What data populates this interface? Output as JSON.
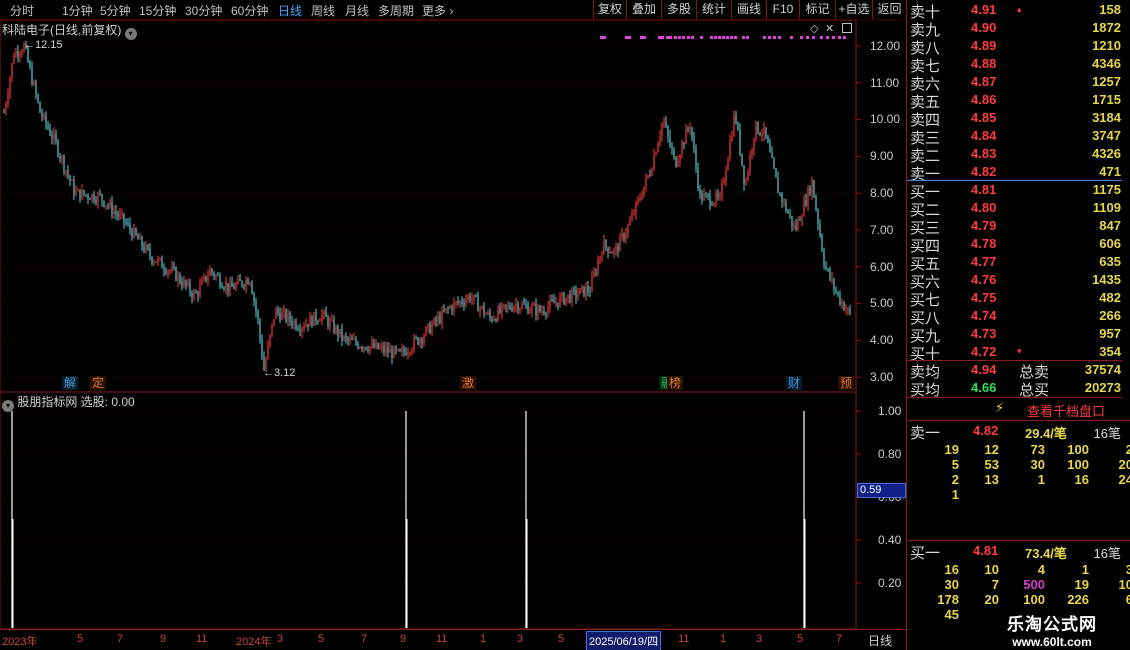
{
  "toolbar": {
    "periods": [
      "分时",
      "1分钟",
      "5分钟",
      "15分钟",
      "30分钟",
      "60分钟",
      "日线",
      "周线",
      "月线",
      "多周期",
      "更多"
    ],
    "active_period": "日线",
    "more_arrow": "›",
    "buttons": [
      "复权",
      "叠加",
      "多股",
      "统计",
      "画线",
      "F10",
      "标记",
      "+自选",
      "返回"
    ]
  },
  "main_chart": {
    "title": "科陆电子(日线,前复权)",
    "high_label": "12.15",
    "low_label": "3.12",
    "y_ticks": [
      "12.00",
      "11.00",
      "10.00",
      "9.00",
      "8.00",
      "7.00",
      "6.00",
      "5.00",
      "4.00",
      "3.00"
    ],
    "badges": [
      {
        "text": "解",
        "color": "#3aa0d8"
      },
      {
        "text": "定",
        "color": "#e07a2a"
      },
      {
        "text": "激",
        "color": "#e07a2a"
      },
      {
        "text": "融",
        "color": "#2ec05a"
      },
      {
        "text": "榜",
        "color": "#e07a2a"
      },
      {
        "text": "财",
        "color": "#3aa0d8"
      },
      {
        "text": "预",
        "color": "#e07a2a"
      }
    ],
    "up_color": "#ff3b3b",
    "down_color": "#5ad0d8",
    "magenta_marker_color": "#e040e0"
  },
  "sub_chart": {
    "title": "股朋指标网 选股: 0.00",
    "y_ticks": [
      "1.00",
      "0.80",
      "0.60",
      "0.40",
      "0.20"
    ],
    "crosshair_value": "0.59"
  },
  "time_axis": {
    "ticks": [
      "2023年",
      "5",
      "7",
      "9",
      "11",
      "2024年",
      "3",
      "5",
      "7",
      "9",
      "11",
      "1",
      "3",
      "5",
      "7",
      "2025/06/19/四",
      "11",
      "1",
      "3",
      "5",
      "7"
    ],
    "period_label": "日线"
  },
  "order_book": {
    "asks": [
      {
        "label": "卖十",
        "price": "4.91",
        "vol": "158"
      },
      {
        "label": "卖九",
        "price": "4.90",
        "vol": "1872"
      },
      {
        "label": "卖八",
        "price": "4.89",
        "vol": "1210"
      },
      {
        "label": "卖七",
        "price": "4.88",
        "vol": "4346"
      },
      {
        "label": "卖六",
        "price": "4.87",
        "vol": "1257"
      },
      {
        "label": "卖五",
        "price": "4.86",
        "vol": "1715"
      },
      {
        "label": "卖四",
        "price": "4.85",
        "vol": "3184"
      },
      {
        "label": "卖三",
        "price": "4.84",
        "vol": "3747"
      },
      {
        "label": "卖二",
        "price": "4.83",
        "vol": "4326"
      },
      {
        "label": "卖一",
        "price": "4.82",
        "vol": "471"
      }
    ],
    "bids": [
      {
        "label": "买一",
        "price": "4.81",
        "vol": "1175"
      },
      {
        "label": "买二",
        "price": "4.80",
        "vol": "1109"
      },
      {
        "label": "买三",
        "price": "4.79",
        "vol": "847"
      },
      {
        "label": "买四",
        "price": "4.78",
        "vol": "606"
      },
      {
        "label": "买五",
        "price": "4.77",
        "vol": "635"
      },
      {
        "label": "买六",
        "price": "4.76",
        "vol": "1435"
      },
      {
        "label": "买七",
        "price": "4.75",
        "vol": "482"
      },
      {
        "label": "买八",
        "price": "4.74",
        "vol": "266"
      },
      {
        "label": "买九",
        "price": "4.73",
        "vol": "957"
      },
      {
        "label": "买十",
        "price": "4.72",
        "vol": "354"
      }
    ],
    "summary": {
      "ask_avg_label": "卖均",
      "ask_avg": "4.94",
      "ask_total_label": "总卖",
      "ask_total": "37574",
      "bid_avg_label": "买均",
      "bid_avg": "4.66",
      "bid_total_label": "总买",
      "bid_total": "20273"
    },
    "depth_button": "查看千档盘口",
    "ask_queue": {
      "label": "卖一",
      "price": "4.82",
      "per_order": "29.4/笔",
      "orders": "16笔",
      "rows": [
        [
          "19",
          "12",
          "73",
          "100",
          "2"
        ],
        [
          "5",
          "53",
          "30",
          "100",
          "20"
        ],
        [
          "2",
          "13",
          "1",
          "16",
          "24"
        ],
        [
          "1",
          "",
          "",
          "",
          ""
        ]
      ]
    },
    "bid_queue": {
      "label": "买一",
      "price": "4.81",
      "per_order": "73.4/笔",
      "orders": "16笔",
      "rows": [
        [
          "16",
          "10",
          "4",
          "1",
          "3"
        ],
        [
          "30",
          "7",
          "500",
          "19",
          "10"
        ],
        [
          "178",
          "20",
          "100",
          "226",
          "6"
        ],
        [
          "45",
          "",
          "",
          "",
          ""
        ]
      ]
    }
  },
  "watermark": {
    "title": "乐淘公式网",
    "url": "www.60lt.com"
  }
}
